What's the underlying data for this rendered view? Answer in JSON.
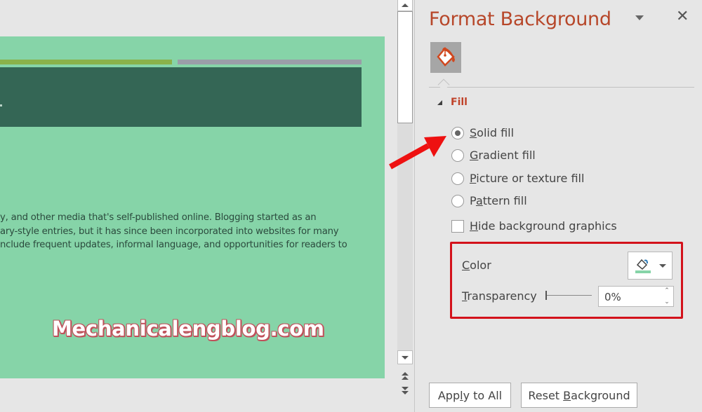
{
  "slide": {
    "body_lines": [
      "y, and other media that's self-published online. Blogging started as an",
      "ary-style entries, but it has since been incorporated into websites for many",
      "nclude frequent updates, informal language, and opportunities for readers to"
    ],
    "watermark": "Mechanicalengblog.com",
    "colors": {
      "background": "#86d4a8",
      "title_band": "#346655",
      "accent_left": "#8ab24b",
      "accent_right": "#9a9ea8"
    }
  },
  "scrollbar": {
    "up_icon": "scroll-up-arrow",
    "down_icon": "scroll-down-arrow",
    "prev_slide_icon": "double-chevron-up",
    "next_slide_icon": "double-chevron-down"
  },
  "pane": {
    "title": "Format Background",
    "options_icon": "chevron-down",
    "close_icon": "✕",
    "tab_icon": "fill-bucket",
    "section": {
      "label": "Fill",
      "expanded": true
    },
    "fill_options": [
      {
        "pre": "",
        "key": "S",
        "rest": "olid fill",
        "checked": true
      },
      {
        "pre": "",
        "key": "G",
        "rest": "radient fill",
        "checked": false
      },
      {
        "pre": "",
        "key": "P",
        "rest": "icture or texture fill",
        "checked": false
      },
      {
        "pre": "P",
        "key": "a",
        "rest": "ttern fill",
        "checked": false
      }
    ],
    "hide_graphics": {
      "key": "H",
      "rest": "ide background graphics",
      "checked": false
    },
    "color": {
      "key": "C",
      "rest": "olor",
      "swatch": "#86d4a8"
    },
    "transparency": {
      "key": "T",
      "rest": "ransparency",
      "value": "0%",
      "fraction": 0
    },
    "buttons": {
      "apply_all": {
        "pre": "App",
        "key": "l",
        "rest": "y to All"
      },
      "reset": {
        "pre": "Reset ",
        "key": "B",
        "rest": "ackground"
      }
    },
    "accent_color": "#b7472a",
    "highlight_color": "#d3121b"
  }
}
